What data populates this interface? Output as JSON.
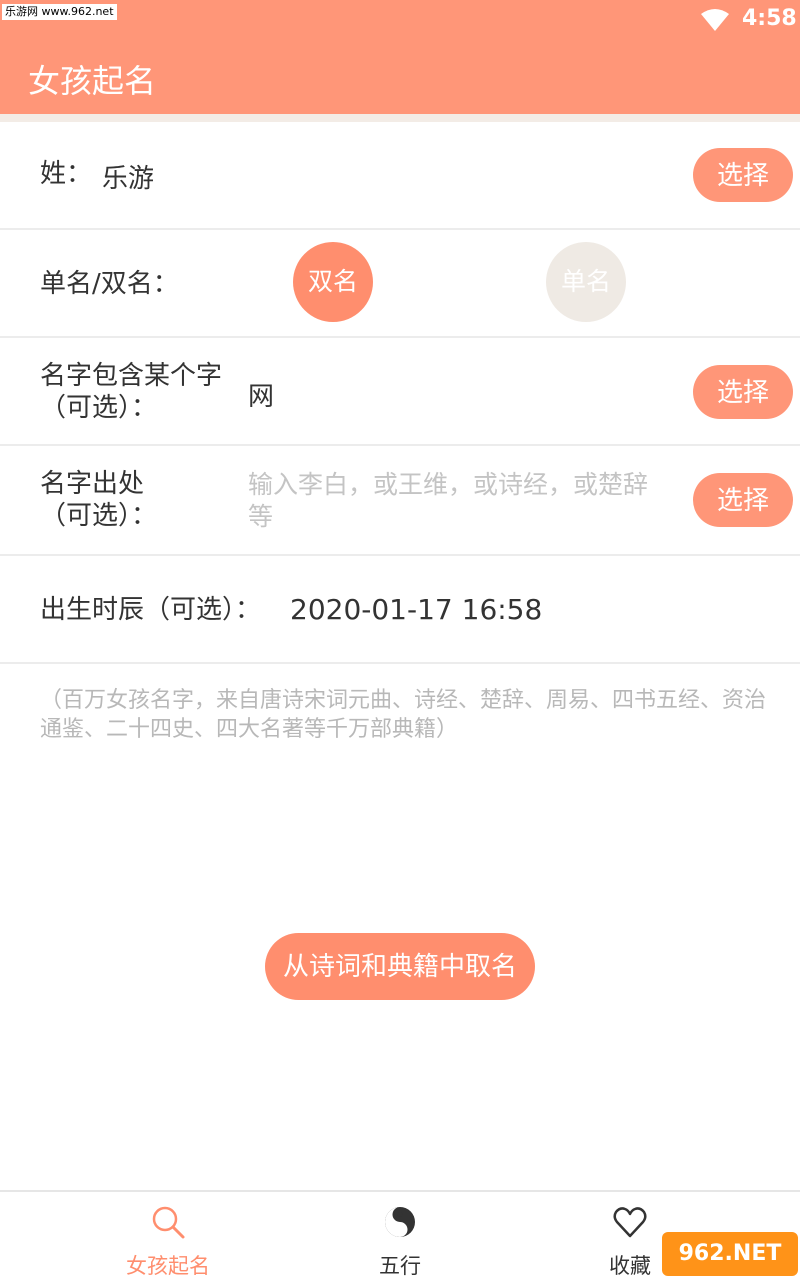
{
  "status_bar": {
    "time": "4:58",
    "watermark": "乐游网 www.962.net"
  },
  "app_bar": {
    "title": "女孩起名"
  },
  "form": {
    "surname": {
      "label": "姓：",
      "value": "乐游",
      "button": "选择"
    },
    "name_type": {
      "label": "单名/双名：",
      "options": [
        "双名",
        "单名"
      ],
      "selected": "双名"
    },
    "contains_char": {
      "label_line1": "名字包含某个字",
      "label_line2": "（可选）：",
      "value": "网",
      "button": "选择"
    },
    "source": {
      "label_line1": "名字出处",
      "label_line2": "（可选）：",
      "placeholder_line1": "输入李白，或王维，或诗经，或楚辞",
      "placeholder_line2": "等",
      "button": "选择"
    },
    "birth_time": {
      "label": "出生时辰（可选）：",
      "value": "2020-01-17 16:58"
    }
  },
  "hint": "（百万女孩名字，来自唐诗宋词元曲、诗经、楚辞、周易、四书五经、资治通鉴、二十四史、四大名著等千万部典籍）",
  "primary_button": "从诗词和典籍中取名",
  "tabs": [
    {
      "label": "女孩起名",
      "icon": "search-icon",
      "active": true
    },
    {
      "label": "五行",
      "icon": "yin-yang-icon",
      "active": false
    },
    {
      "label": "收藏",
      "icon": "heart-icon",
      "active": false
    }
  ],
  "corner_watermark": "962.NET",
  "colors": {
    "accent": "#ff9678",
    "button": "#ff8e6e",
    "inactive_circle": "#efeae4"
  }
}
